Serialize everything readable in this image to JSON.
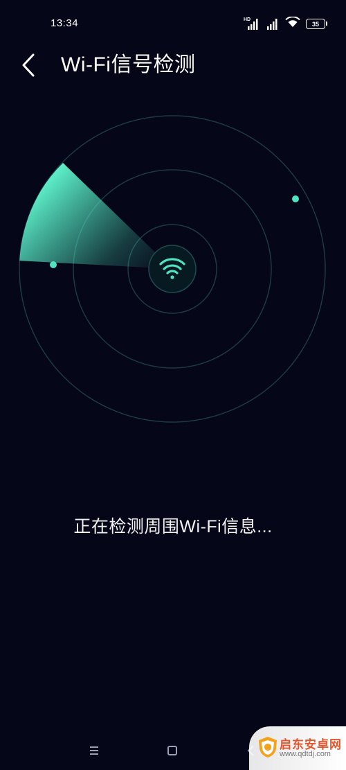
{
  "status_bar": {
    "time": "13:34",
    "network_badge": "HD",
    "battery_level": "35"
  },
  "header": {
    "title": "Wi-Fi信号检测"
  },
  "scan": {
    "status_text": "正在检测周围Wi-Fi信息..."
  },
  "colors": {
    "background": "#050617",
    "accent": "#4fe3c0",
    "ring": "#1d3a44"
  },
  "icons": {
    "back": "chevron-left-icon",
    "center": "wifi-icon",
    "nav_menu": "menu-icon",
    "nav_home": "square-icon",
    "nav_back": "triangle-back-icon"
  },
  "watermark": {
    "name": "启东安卓网",
    "url": "www.qdtdj.com"
  }
}
